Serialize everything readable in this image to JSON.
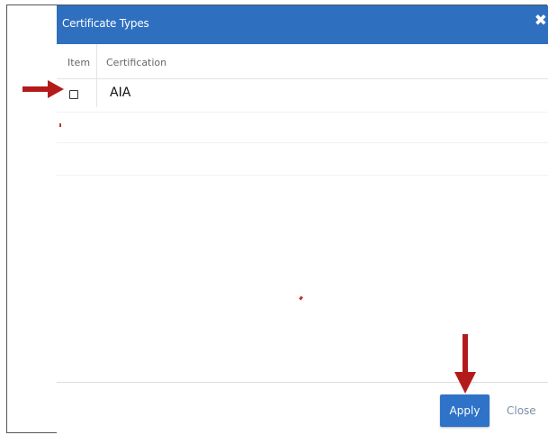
{
  "dialog": {
    "title": "Certificate Types",
    "close_glyph": "✕"
  },
  "table": {
    "headers": [
      "Item",
      "Certification"
    ],
    "rows": [
      {
        "label": "AIA",
        "checked": false
      }
    ]
  },
  "footer": {
    "apply_label": "Apply",
    "close_label": "Close"
  },
  "colors": {
    "header_bg": "#2e6fc0",
    "apply_bg": "#2e73c8",
    "annotation_arrow": "#b31b1b"
  },
  "icons": {
    "close": "close-icon",
    "arrow_right": "arrow-right-icon",
    "arrow_down": "arrow-down-icon"
  }
}
